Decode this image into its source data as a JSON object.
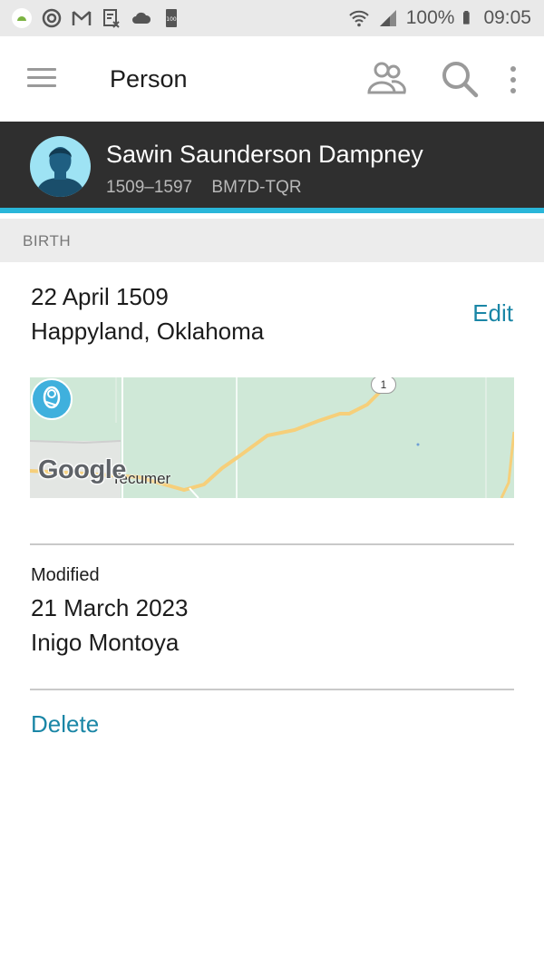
{
  "status_bar": {
    "battery": "100%",
    "time": "09:05",
    "small_badge": "100"
  },
  "app_bar": {
    "title": "Person"
  },
  "person": {
    "name": "Sawin Saunderson Dampney",
    "lifespan": "1509–1597",
    "id": "BM7D-TQR"
  },
  "section": {
    "title": "BIRTH"
  },
  "birth": {
    "date": "22 April 1509",
    "place": "Happyland, Oklahoma",
    "edit_label": "Edit"
  },
  "map": {
    "logo": "Google",
    "town_label": "Tecumer",
    "route_label": "1"
  },
  "modified": {
    "label": "Modified",
    "date": "21 March 2023",
    "by": "Inigo Montoya"
  },
  "actions": {
    "delete_label": "Delete"
  },
  "colors": {
    "accent": "#1a86a6",
    "header_bg": "#2f2f2f",
    "header_stripe": "#29b6d9",
    "map_green": "#cfe8d7"
  }
}
